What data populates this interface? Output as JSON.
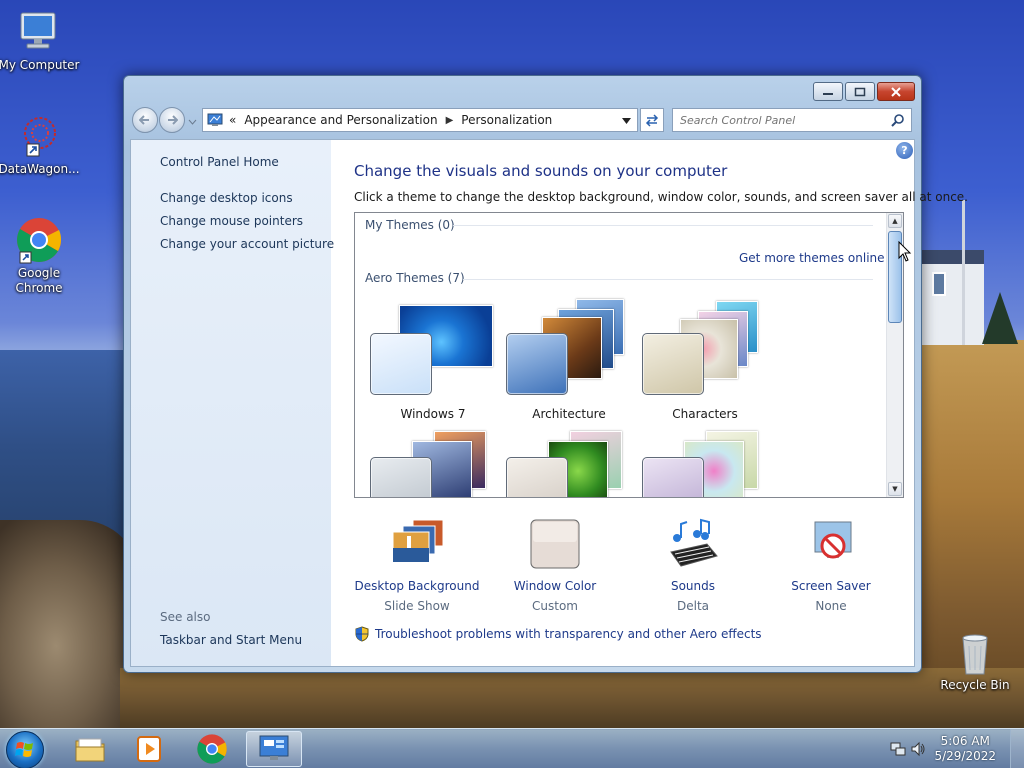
{
  "desktop": {
    "icons": [
      {
        "label": "My Computer"
      },
      {
        "label": "DataWagon..."
      },
      {
        "label": "Google Chrome"
      },
      {
        "label": "Recycle Bin"
      }
    ]
  },
  "window": {
    "address": {
      "overflow": "«",
      "crumbs": [
        "Appearance and Personalization",
        "Personalization"
      ]
    },
    "search": {
      "placeholder": "Search Control Panel"
    },
    "left_pane": {
      "home": "Control Panel Home",
      "links": [
        "Change desktop icons",
        "Change mouse pointers",
        "Change your account picture"
      ],
      "see_also": "See also",
      "see_also_links": [
        "Taskbar and Start Menu"
      ]
    },
    "main": {
      "heading": "Change the visuals and sounds on your computer",
      "subtitle": "Click a theme to change the desktop background, window color, sounds, and screen saver all at once.",
      "my_themes": "My Themes (0)",
      "get_more": "Get more themes online",
      "aero_themes": "Aero Themes (7)",
      "themes": [
        "Windows 7",
        "Architecture",
        "Characters"
      ],
      "bottom": [
        {
          "label": "Desktop Background",
          "value": "Slide Show"
        },
        {
          "label": "Window Color",
          "value": "Custom"
        },
        {
          "label": "Sounds",
          "value": "Delta"
        },
        {
          "label": "Screen Saver",
          "value": "None"
        }
      ],
      "troubleshoot": "Troubleshoot problems with transparency and other Aero effects"
    }
  },
  "taskbar": {
    "time": "5:06 AM",
    "date": "5/29/2022"
  }
}
